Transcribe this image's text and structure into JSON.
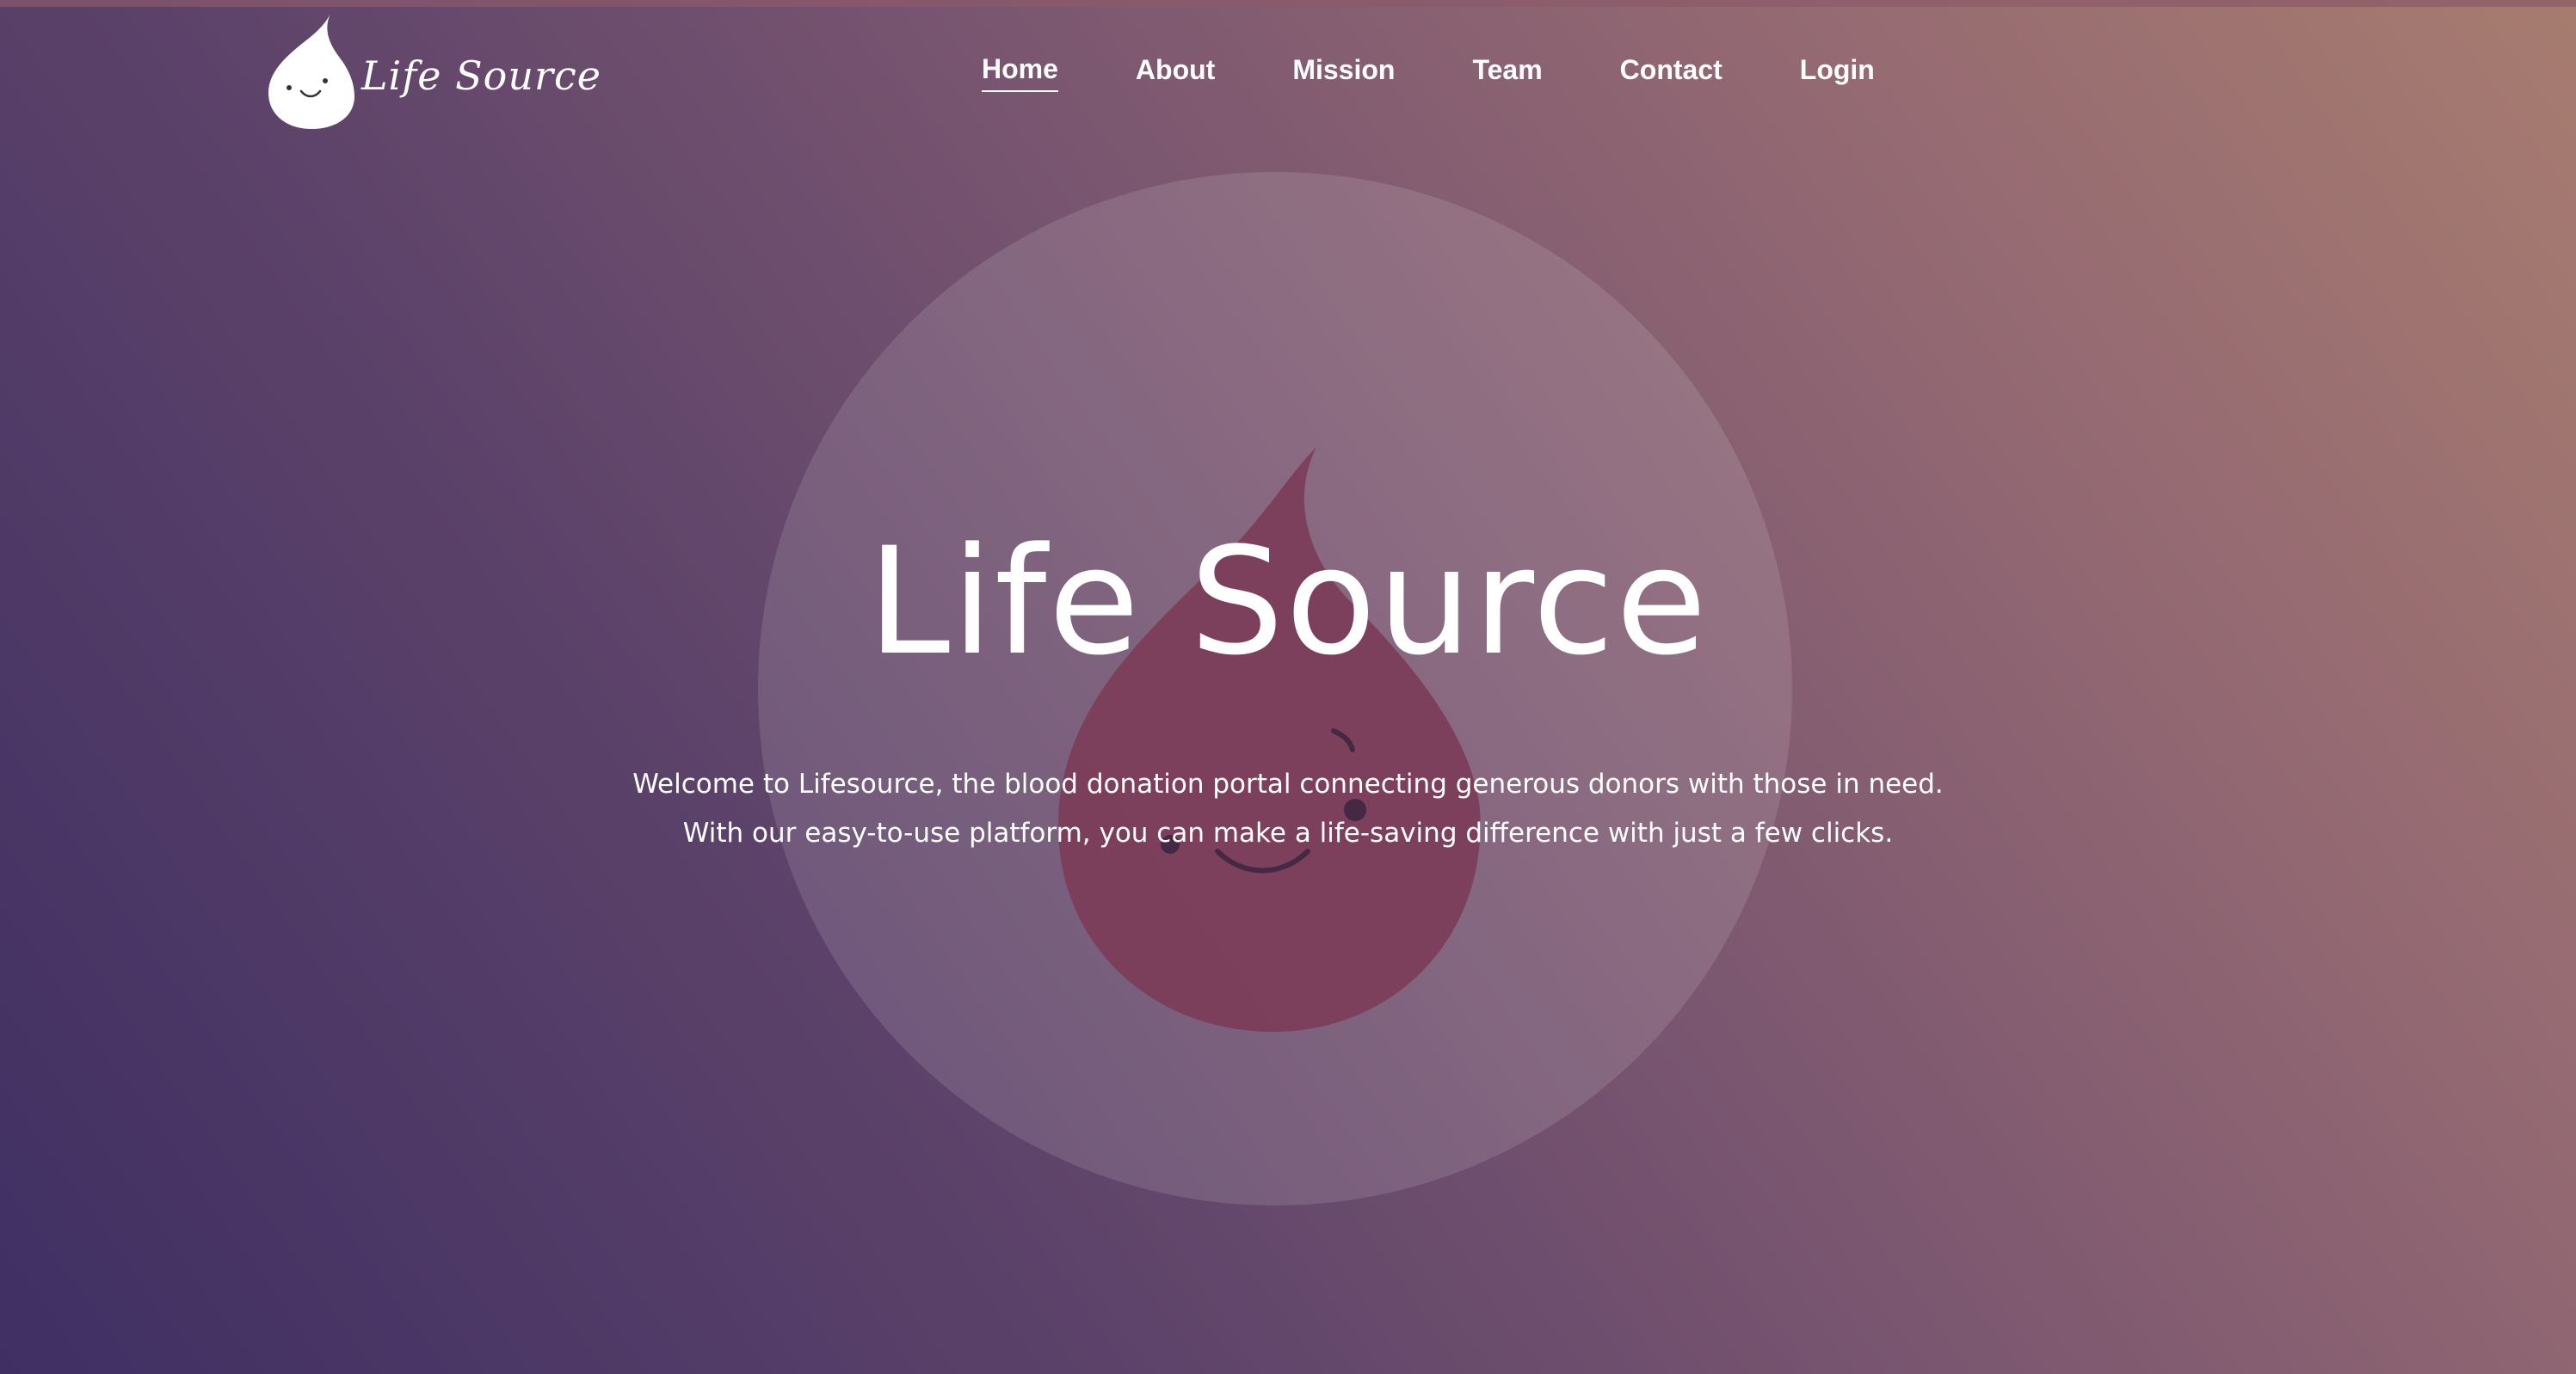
{
  "brand": {
    "name": "Life Source",
    "logo_icon": "blood-drop-smiley-icon"
  },
  "nav": {
    "items": [
      {
        "label": "Home",
        "active": true
      },
      {
        "label": "About",
        "active": false
      },
      {
        "label": "Mission",
        "active": false
      },
      {
        "label": "Team",
        "active": false
      },
      {
        "label": "Contact",
        "active": false
      },
      {
        "label": "Login",
        "active": false
      }
    ]
  },
  "hero": {
    "title": "Life Source",
    "lines": [
      "Welcome to Lifesource, the blood donation portal connecting generous donors with those in need.",
      "With our easy-to-use platform, you can make a life-saving difference with just a few clicks."
    ],
    "illustration_icon": "blood-drop-mascot-icon"
  },
  "colors": {
    "gradient_start": "#3f2f63",
    "gradient_end": "#a77c6f",
    "drop_red": "#7a3a55",
    "text": "#ffffff"
  }
}
